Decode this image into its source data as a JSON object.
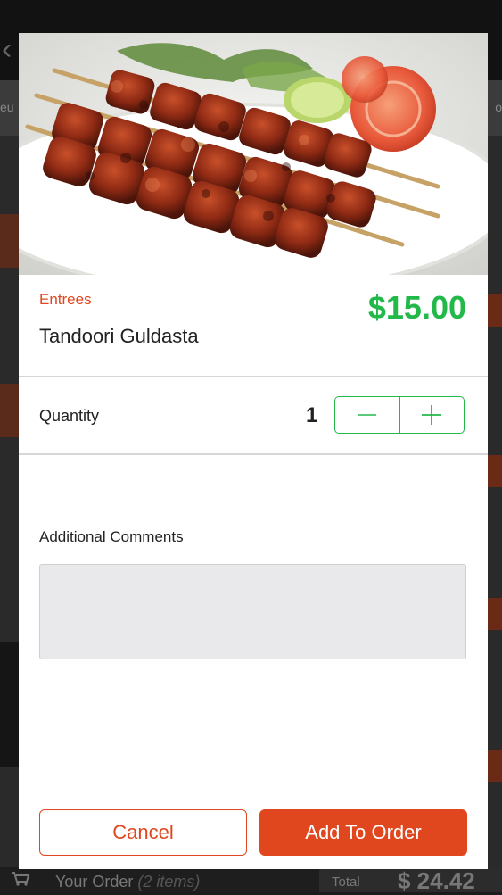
{
  "background": {
    "tab_left": "eu",
    "tab_right": "o",
    "order_label": "Your Order",
    "order_count": "(2 items)",
    "total_label": "Total",
    "total_value": "$ 24.42"
  },
  "item": {
    "image_icon": "kebab-skewers-photo",
    "category": "Entrees",
    "name": "Tandoori Guldasta",
    "price": "$15.00"
  },
  "quantity": {
    "label": "Quantity",
    "value": "1",
    "decrement_icon": "minus-icon",
    "increment_icon": "plus-icon"
  },
  "comments": {
    "label": "Additional Comments",
    "value": ""
  },
  "actions": {
    "cancel_label": "Cancel",
    "add_label": "Add To Order"
  },
  "colors": {
    "accent": "#e0471f",
    "price": "#22b84a",
    "stepper_border": "#22b84a"
  }
}
